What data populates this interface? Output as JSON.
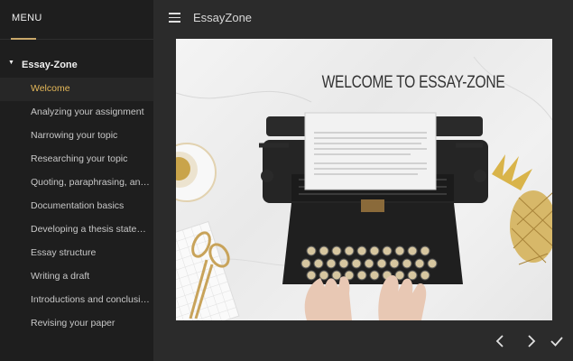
{
  "sidebar": {
    "menu_title": "MENU",
    "section_label": "Essay-Zone",
    "items": [
      {
        "label": "Welcome",
        "active": true
      },
      {
        "label": "Analyzing your assignment"
      },
      {
        "label": "Narrowing your topic"
      },
      {
        "label": "Researching your topic"
      },
      {
        "label": "Quoting, paraphrasing, and..."
      },
      {
        "label": "Documentation basics"
      },
      {
        "label": "Developing a thesis statem..."
      },
      {
        "label": "Essay structure"
      },
      {
        "label": "Writing a draft"
      },
      {
        "label": "Introductions and conclusio..."
      },
      {
        "label": "Revising your paper"
      }
    ]
  },
  "header": {
    "app_title": "EssayZone"
  },
  "slide": {
    "title": "WELCOME TO ESSAY-ZONE"
  },
  "colors": {
    "accent": "#e5b859",
    "sidebar_bg": "#1e1e1e",
    "main_bg": "#2b2b2b"
  },
  "icons": {
    "menu": "hamburger-icon",
    "prev": "chevron-left-icon",
    "next": "chevron-right-icon",
    "complete": "checkmark-icon"
  }
}
